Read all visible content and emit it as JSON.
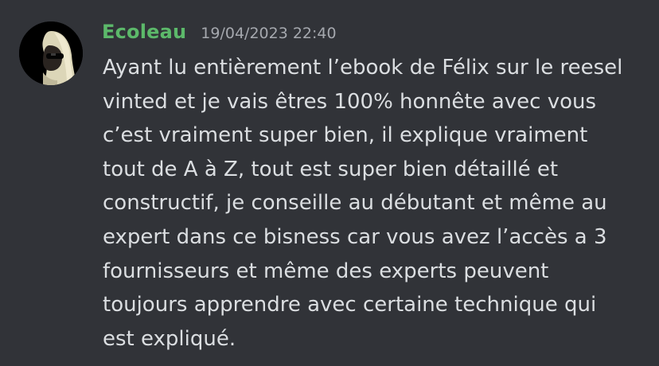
{
  "author": {
    "name": "Ecoleau",
    "name_color": "#5cb96a",
    "avatar_icon": "hooded-figure-sunglasses-avatar"
  },
  "message": {
    "timestamp": "19/04/2023 22:40",
    "lines": [
      "Ayant lu entièrement l’ebook de Félix sur le reesel",
      "vinted et je vais êtres 100% honnête avec vous",
      "c’est vraiment super bien, il explique vraiment",
      "tout de A à Z, tout est super bien détaillé et",
      "constructif, je conseille au débutant et même au",
      "expert dans ce bisness car vous avez l’accès a 3",
      "fournisseurs et même des experts peuvent",
      "toujours apprendre avec certaine technique qui",
      "est expliqué."
    ]
  },
  "colors": {
    "background": "#313338",
    "text": "#dbdee1",
    "timestamp": "#a5a8ae"
  }
}
